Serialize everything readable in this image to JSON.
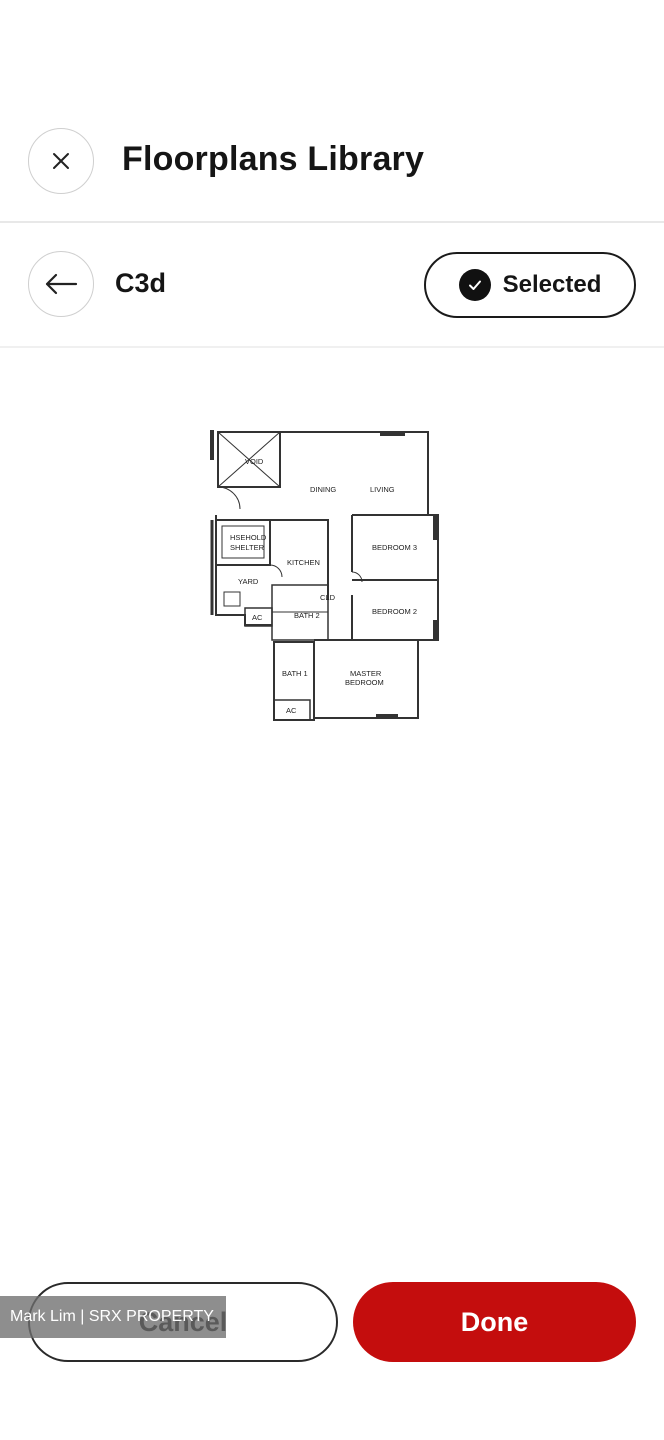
{
  "header": {
    "title": "Floorplans Library",
    "close_icon": "close-icon"
  },
  "subbar": {
    "plan_name": "C3d",
    "back_icon": "arrow-left-icon",
    "selected_label": "Selected",
    "check_icon": "check-circle-icon"
  },
  "floorplan": {
    "rooms": {
      "void": "VOID",
      "dining": "DINING",
      "living": "LIVING",
      "hshold": "HSEHOLD",
      "shelter": "SHELTER",
      "kitchen": "KITCHEN",
      "bedroom3": "BEDROOM 3",
      "yard": "YARD",
      "cld": "CLD",
      "bedroom2": "BEDROOM 2",
      "ac1": "AC",
      "bath2": "BATH 2",
      "bath1": "BATH 1",
      "master1": "MASTER",
      "master2": "BEDROOM",
      "ac2": "AC"
    }
  },
  "footer": {
    "cancel_label": "Cancel",
    "done_label": "Done"
  },
  "watermark": "Mark Lim | SRX PROPERTY",
  "colors": {
    "accent": "#c40d0d"
  }
}
